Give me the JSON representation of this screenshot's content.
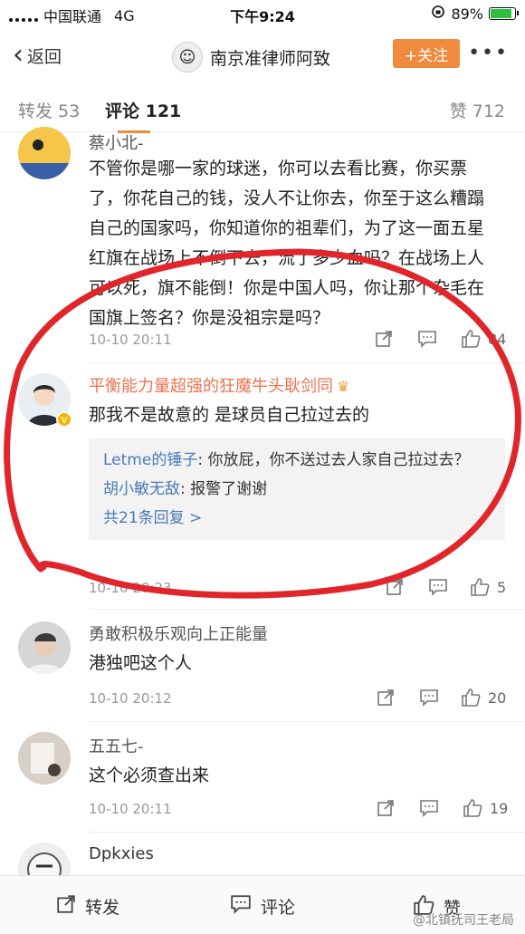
{
  "status_bar": {
    "carrier": "中国联通",
    "network": "4G",
    "time": "下午9:24",
    "battery": "89%",
    "battery_level": 0.89
  },
  "nav": {
    "back_label": "返回",
    "title": "南京准律师阿致",
    "follow_label": "+关注",
    "more": "•••"
  },
  "tabs": {
    "repost": "转发 53",
    "comments": "评论 121",
    "likes": "赞 712"
  },
  "comments": [
    {
      "username": "蔡小北-",
      "text": "不管你是哪一家的球迷，你可以去看比赛，你买票了，你花自己的钱，没人不让你去，你至于这么糟蹋自己的国家吗，你知道你的祖辈们，为了这一面五星红旗在战场上不倒下去，流了多少血吗？在战场上人可以死，旗不能倒！你是中国人吗，你让那个杂毛在国旗上签名？你是没祖宗是吗？",
      "time": "10-10 20:11",
      "likes": "84"
    },
    {
      "username": "平衡能力量超强的狂魔牛头耿剑同",
      "text": "那我不是故意的 是球员自己拉过去的",
      "time": "10-10 20:23",
      "likes": "5",
      "replies": [
        {
          "user": "Letme的锤子",
          "text": ": 你放屁，你不送过去人家自己拉过去？"
        },
        {
          "user": "胡小敏无敌",
          "text": ": 报警了谢谢"
        }
      ],
      "more_replies": "共21条回复 >"
    },
    {
      "username": "勇敢积极乐观向上正能量",
      "text": "港独吧这个人",
      "time": "10-10 20:12",
      "likes": "20"
    },
    {
      "username": "五五七-",
      "text": "这个必须查出来",
      "time": "10-10 20:11",
      "likes": "19"
    },
    {
      "username": "Dpkxies"
    }
  ],
  "bottom_bar": {
    "repost": "转发",
    "comment": "评论",
    "like": "赞"
  },
  "watermark": "@北镇抚司王老局",
  "colors": {
    "accent": "#f08a3c",
    "vip_name": "#eb7350",
    "link": "#4a7ab7",
    "annotation": "#e0262b"
  }
}
